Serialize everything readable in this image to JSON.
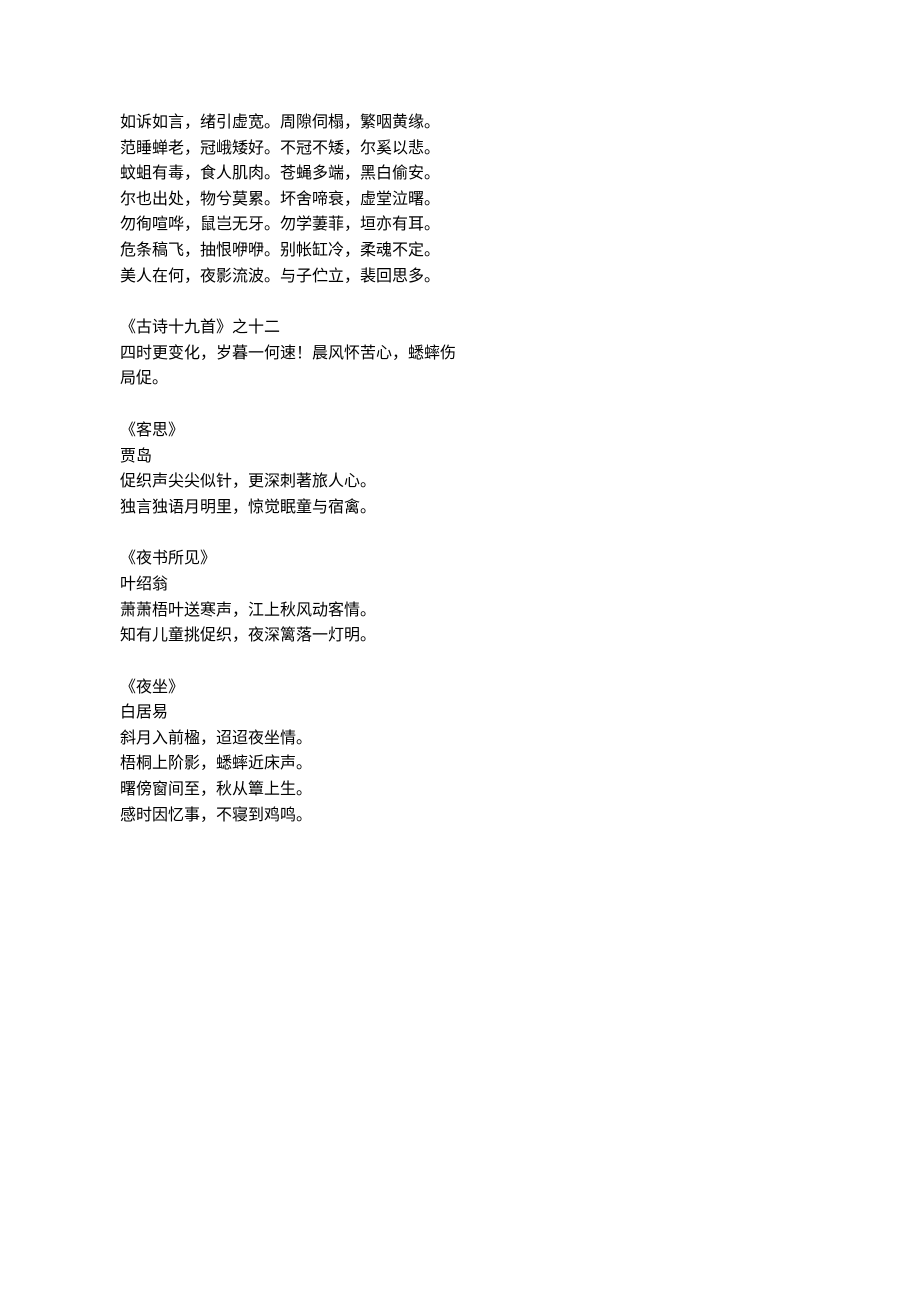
{
  "blocks": [
    {
      "id": "poem-untitled-first",
      "lines": [
        "如诉如言，绪引虚宽。周隙伺榻，繁咽黄缘。",
        "范睡蝉老，冠峨矮好。不冠不矮，尔奚以悲。",
        "蚊蛆有毒，食人肌肉。苍蝇多端，黑白偷安。",
        "尔也出处，物兮莫累。坏舍啼衰，虚堂泣曙。",
        "勿徇喧哗，鼠岂无牙。勿学萋菲，垣亦有耳。",
        "危条稿飞，抽恨咿咿。别帐缸冷，柔魂不定。",
        "美人在何，夜影流波。与子伫立，裴回思多。"
      ]
    },
    {
      "id": "poem-nineteen-12",
      "lines": [
        "《古诗十九首》之十二",
        "四时更变化，岁暮一何速！晨风怀苦心，蟋蟀伤",
        "局促。"
      ]
    },
    {
      "id": "poem-kesi",
      "lines": [
        "《客思》",
        "贾岛",
        "促织声尖尖似针，更深刺著旅人心。",
        "独言独语月明里，惊觉眠童与宿禽。"
      ]
    },
    {
      "id": "poem-yeshu-suojian",
      "lines": [
        "《夜书所见》",
        "叶绍翁",
        "萧萧梧叶送寒声，江上秋风动客情。",
        "知有儿童挑促织，夜深篱落一灯明。"
      ]
    },
    {
      "id": "poem-yezuo",
      "lines": [
        "《夜坐》",
        "白居易",
        "斜月入前楹，迢迢夜坐情。",
        "梧桐上阶影，蟋蟀近床声。",
        "曙傍窗间至，秋从簟上生。",
        "感时因忆事，不寝到鸡鸣。"
      ]
    }
  ]
}
